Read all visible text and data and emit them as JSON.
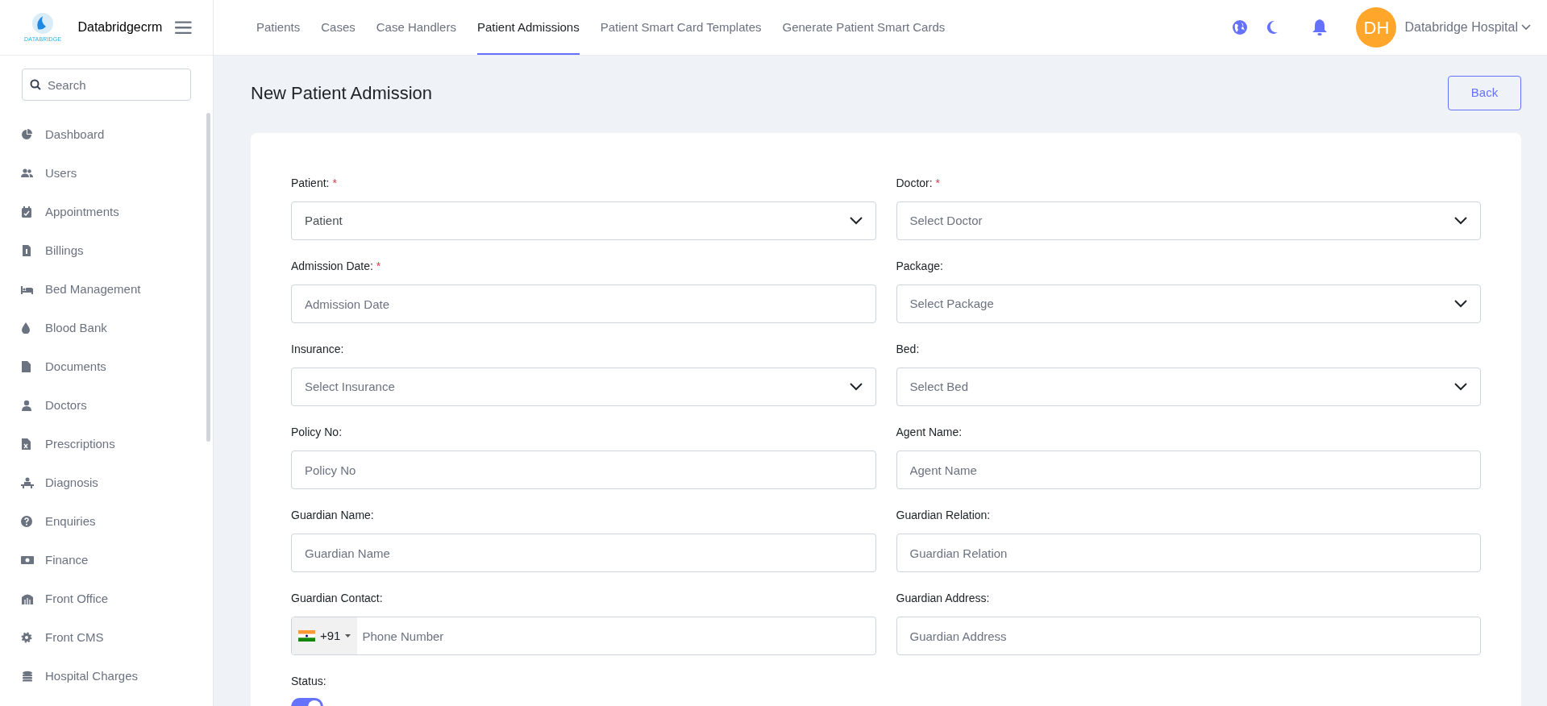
{
  "brand": {
    "name": "Databridgecrm",
    "logo_text": "DATABRIDGE"
  },
  "sidebar": {
    "search": {
      "placeholder": "Search"
    },
    "items": [
      {
        "label": "Dashboard"
      },
      {
        "label": "Users"
      },
      {
        "label": "Appointments"
      },
      {
        "label": "Billings"
      },
      {
        "label": "Bed Management"
      },
      {
        "label": "Blood Bank"
      },
      {
        "label": "Documents"
      },
      {
        "label": "Doctors"
      },
      {
        "label": "Prescriptions"
      },
      {
        "label": "Diagnosis"
      },
      {
        "label": "Enquiries"
      },
      {
        "label": "Finance"
      },
      {
        "label": "Front Office"
      },
      {
        "label": "Front CMS"
      },
      {
        "label": "Hospital Charges"
      }
    ]
  },
  "tabs": [
    {
      "label": "Patients",
      "selected": false
    },
    {
      "label": "Cases",
      "selected": false
    },
    {
      "label": "Case Handlers",
      "selected": false
    },
    {
      "label": "Patient Admissions",
      "selected": true
    },
    {
      "label": "Patient Smart Card Templates",
      "selected": false
    },
    {
      "label": "Generate Patient Smart Cards",
      "selected": false
    }
  ],
  "user": {
    "initials": "DH",
    "name": "Databridge Hospital"
  },
  "page": {
    "title": "New Patient Admission",
    "back_button": "Back"
  },
  "form": {
    "fields": [
      {
        "label": "Patient:",
        "required_mark": "*",
        "kind": "select",
        "value": "Patient"
      },
      {
        "label": "Doctor:",
        "required_mark": "*",
        "kind": "select",
        "placeholder": "Select Doctor"
      },
      {
        "label": "Admission Date:",
        "required_mark": "*",
        "kind": "text",
        "placeholder": "Admission Date"
      },
      {
        "label": "Package:",
        "kind": "select",
        "placeholder": "Select Package"
      },
      {
        "label": "Insurance:",
        "kind": "select",
        "placeholder": "Select Insurance"
      },
      {
        "label": "Bed:",
        "kind": "select",
        "placeholder": "Select Bed"
      },
      {
        "label": "Policy No:",
        "kind": "text",
        "placeholder": "Policy No"
      },
      {
        "label": "Agent Name:",
        "kind": "text",
        "placeholder": "Agent Name"
      },
      {
        "label": "Guardian Name:",
        "kind": "text",
        "placeholder": "Guardian Name"
      },
      {
        "label": "Guardian Relation:",
        "kind": "text",
        "placeholder": "Guardian Relation"
      },
      {
        "label": "Guardian Contact:",
        "kind": "phone",
        "dial_code": "+91",
        "placeholder": "Phone Number"
      },
      {
        "label": "Guardian Address:",
        "kind": "text",
        "placeholder": "Guardian Address"
      }
    ],
    "status": {
      "label": "Status:",
      "on": true
    }
  }
}
